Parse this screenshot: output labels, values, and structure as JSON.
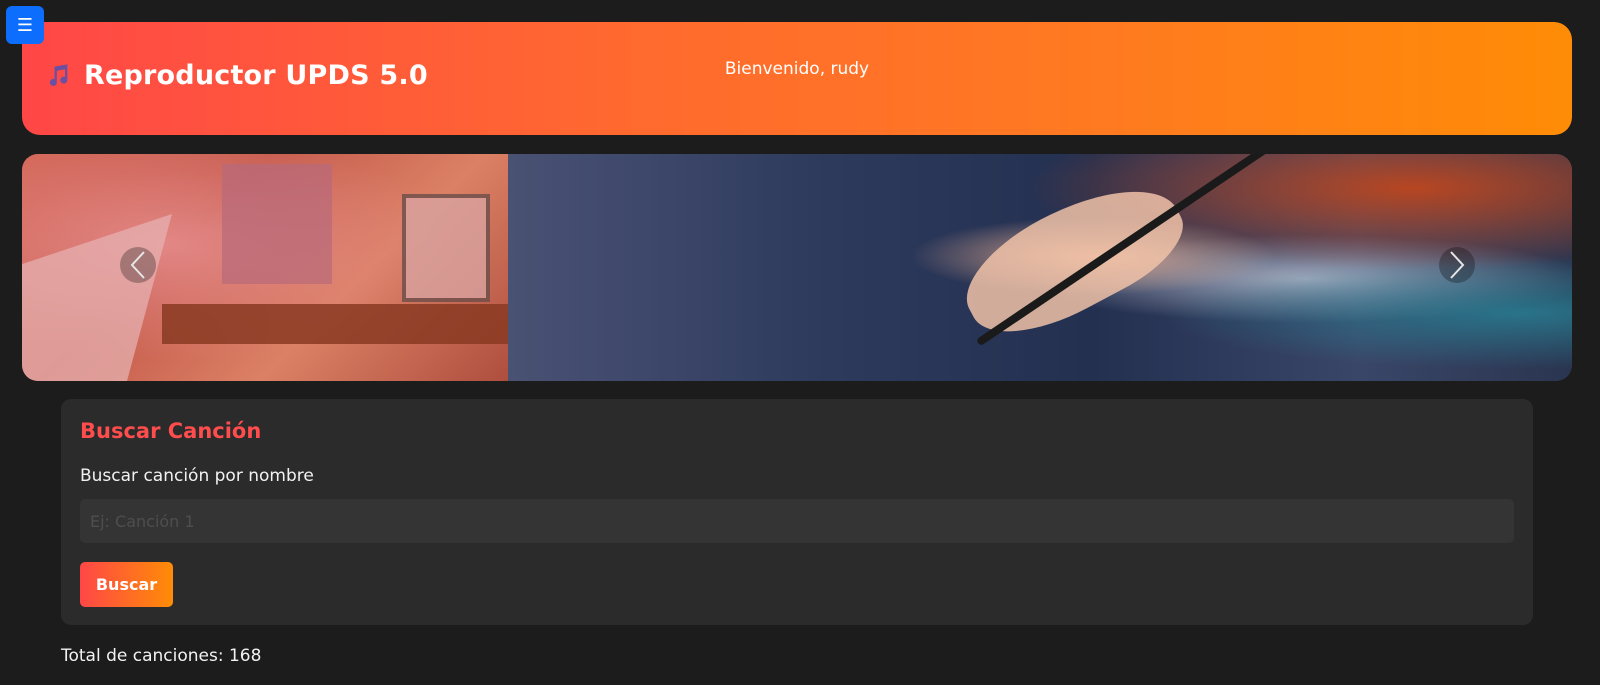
{
  "menu": {
    "icon": "hamburger-icon",
    "glyph": "☰"
  },
  "header": {
    "brand_icon": "music-notes-icon",
    "title": "Reproductor UPDS 5.0",
    "welcome": "Bienvenido, rudy"
  },
  "carousel": {
    "prev_icon": "chevron-left-icon",
    "next_icon": "chevron-right-icon"
  },
  "search": {
    "title": "Buscar Canción",
    "label": "Buscar canción por nombre",
    "placeholder": "Ej: Canción 1",
    "value": "",
    "button_label": "Buscar"
  },
  "stats": {
    "total_text": "Total de canciones: 168"
  },
  "colors": {
    "accent_red": "#ff4d4d",
    "gradient_start": "#ff4747",
    "gradient_end": "#ff8c06",
    "menu_blue": "#0d6efd",
    "background": "#1c1c1c",
    "card": "#2b2b2b"
  }
}
